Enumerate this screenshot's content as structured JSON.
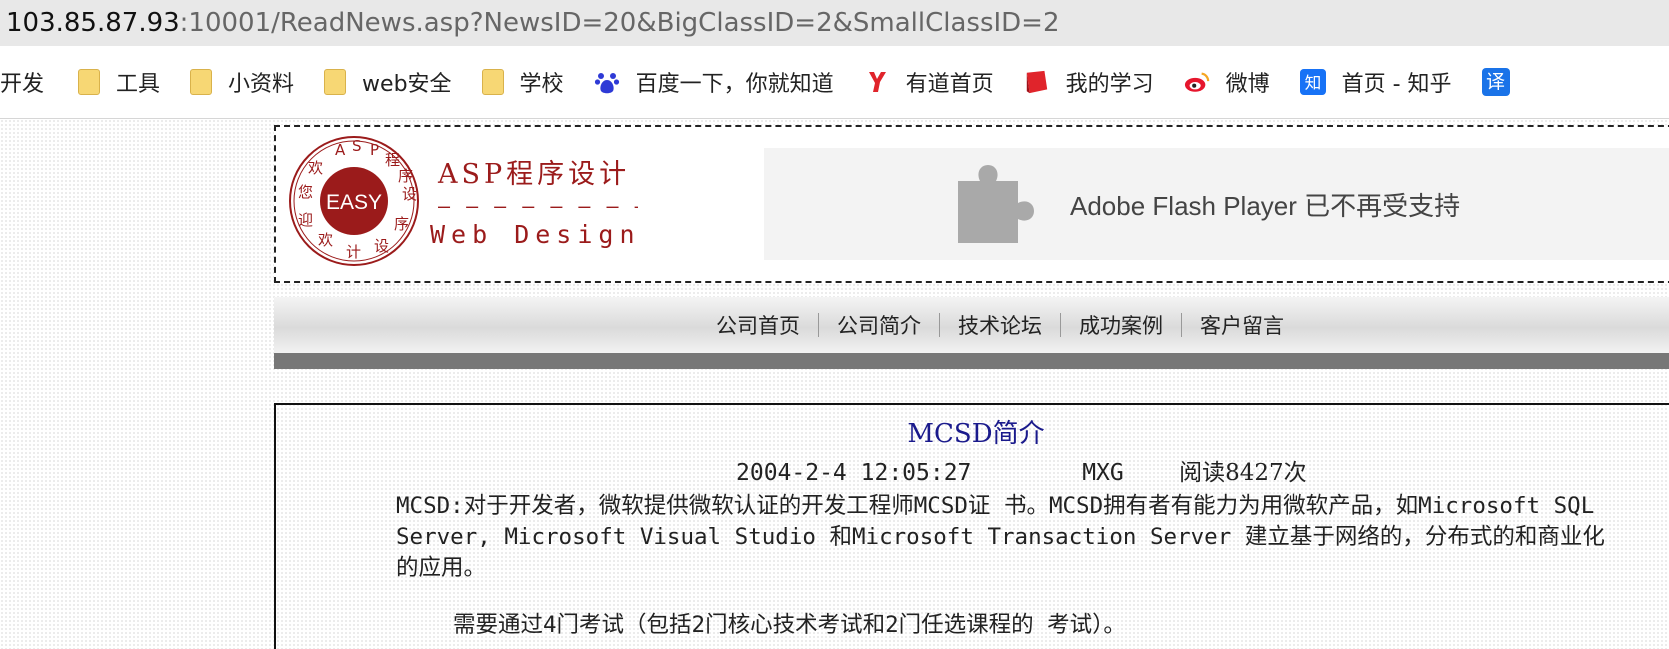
{
  "browser": {
    "address": {
      "host": "103.85.87.93",
      "path": ":10001/ReadNews.asp?NewsID=20&BigClassID=2&SmallClassID=2"
    },
    "bookmarks": [
      {
        "label": "开发",
        "icon": "none"
      },
      {
        "label": "工具",
        "icon": "folder-icon"
      },
      {
        "label": "小资料",
        "icon": "folder-icon"
      },
      {
        "label": "web安全",
        "icon": "folder-icon"
      },
      {
        "label": "学校",
        "icon": "folder-icon"
      },
      {
        "label": "百度一下，你就知道",
        "icon": "baidu-icon"
      },
      {
        "label": "有道首页",
        "icon": "youdao-icon"
      },
      {
        "label": "我的学习",
        "icon": "book-icon"
      },
      {
        "label": "微博",
        "icon": "weibo-icon"
      },
      {
        "label": "首页 - 知乎",
        "icon": "zhihu-icon"
      },
      {
        "label": "",
        "icon": "translate-icon",
        "glyph": "译"
      }
    ]
  },
  "header": {
    "logo": {
      "badge_text": "EASY",
      "title": "ASP程序设计",
      "subtitle": "Web Design",
      "ring_text": "ASP程序设计欢迎您"
    },
    "flash_notice": "Adobe Flash Player 已不再受支持"
  },
  "nav": {
    "items": [
      "公司首页",
      "公司简介",
      "技术论坛",
      "成功案例",
      "客户留言"
    ]
  },
  "article": {
    "title": "MCSD简介",
    "date": "2004-2-4 12:05:27",
    "author": "MXG",
    "views": "阅读8427次",
    "paragraph1": "MCSD:对于开发者，微软提供微软认证的开发工程师MCSD证 书。MCSD拥有者有能力为用微软产品，如Microsoft SQL Server, Microsoft Visual Studio 和Microsoft Transaction Server 建立基于网络的，分布式的和商业化 的应用。",
    "paragraph2": "需要通过4门考试（包括2门核心技术考试和2门任选课程的 考试）。"
  },
  "colors": {
    "logo_red": "#9b1b1b",
    "title_blue": "#1a1a8c",
    "nav_bar_dark": "#777777"
  }
}
